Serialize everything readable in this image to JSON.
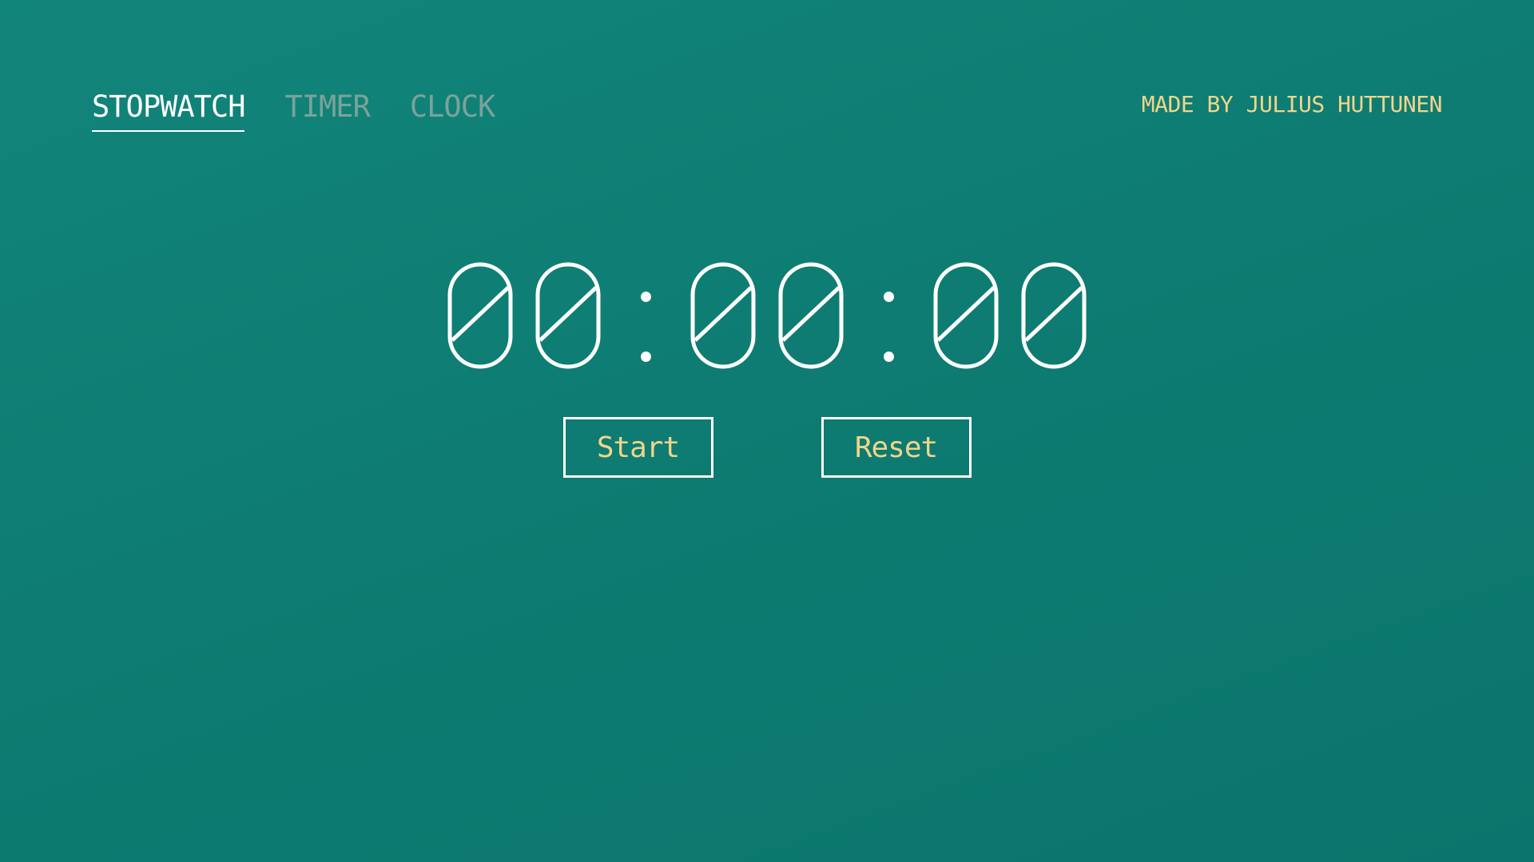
{
  "nav": {
    "tabs": [
      {
        "label": "STOPWATCH",
        "active": true
      },
      {
        "label": "TIMER",
        "active": false
      },
      {
        "label": "CLOCK",
        "active": false
      }
    ]
  },
  "credit": "MADE BY JULIUS HUTTUNEN",
  "display": {
    "time": "00:00:00",
    "hours": [
      "0",
      "0"
    ],
    "minutes": [
      "0",
      "0"
    ],
    "seconds": [
      "0",
      "0"
    ]
  },
  "controls": {
    "start_label": "Start",
    "reset_label": "Reset"
  },
  "colors": {
    "background": "#0e7c72",
    "accent": "#f1d58a",
    "active_text": "#ffffff",
    "inactive_text": "#7aa39b"
  }
}
